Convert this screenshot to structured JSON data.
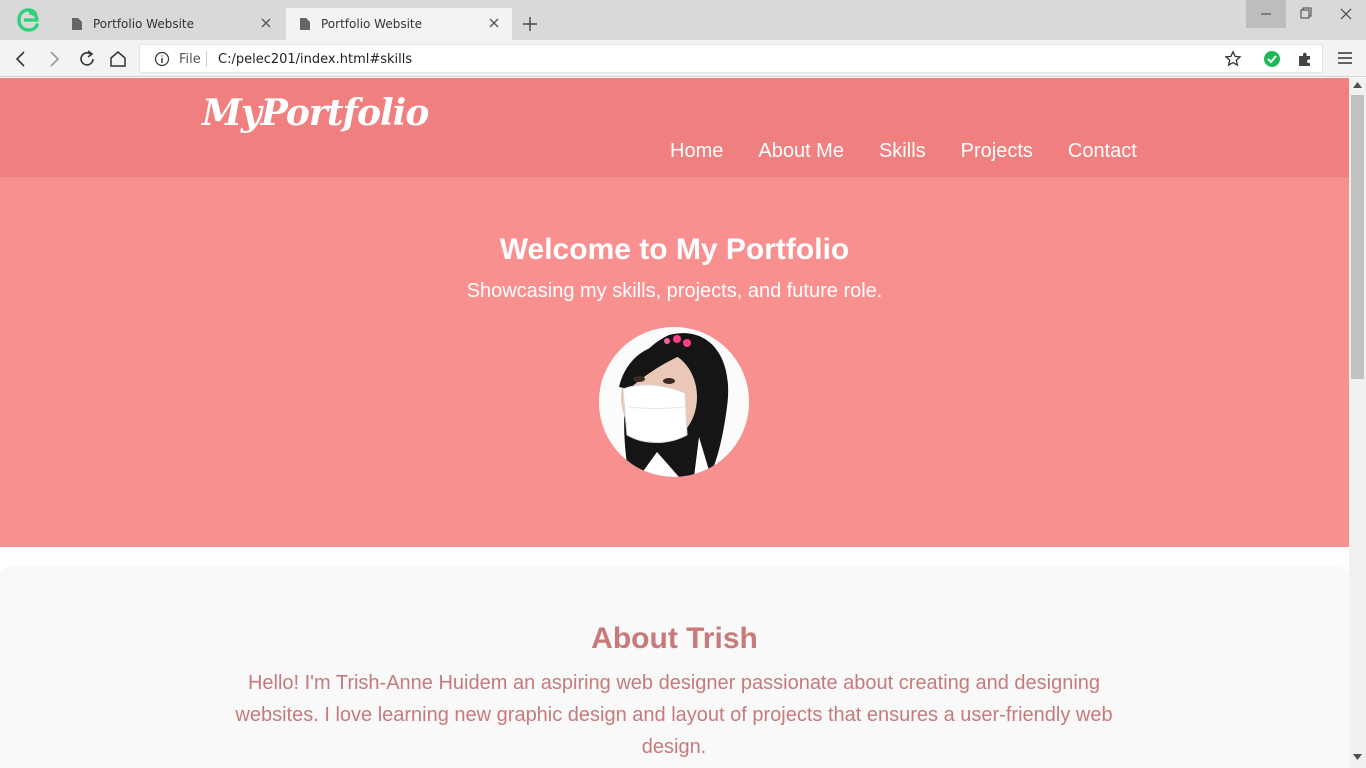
{
  "browser": {
    "tabs": [
      {
        "title": "Portfolio Website",
        "active": false
      },
      {
        "title": "Portfolio Website",
        "active": true
      }
    ],
    "address": {
      "scheme_label": "File",
      "url": "C:/pelec201/index.html#skills"
    }
  },
  "site": {
    "logo": "MyPortfolio",
    "nav": [
      "Home",
      "About Me",
      "Skills",
      "Projects",
      "Contact"
    ],
    "hero": {
      "title": "Welcome to My Portfolio",
      "subtitle": "Showcasing my skills, projects, and future role."
    },
    "about": {
      "title": "About Trish",
      "text": "Hello! I'm Trish-Anne Huidem an aspiring web designer passionate about creating and designing websites. I love learning new graphic design and layout of projects that ensures a user-friendly web design."
    }
  },
  "colors": {
    "header_bg": "#f08080",
    "hero_bg": "#f89090",
    "about_bg": "#f9f9f9",
    "about_text": "#c77a7a",
    "browser_logo": "#2fd17a"
  },
  "icons": [
    "browser-logo-icon",
    "file-icon",
    "close-icon",
    "plus-icon",
    "minimize-icon",
    "restore-icon",
    "back-icon",
    "forward-icon",
    "reload-icon",
    "home-icon",
    "info-icon",
    "star-icon",
    "check-circle-icon",
    "puzzle-icon",
    "menu-icon"
  ]
}
